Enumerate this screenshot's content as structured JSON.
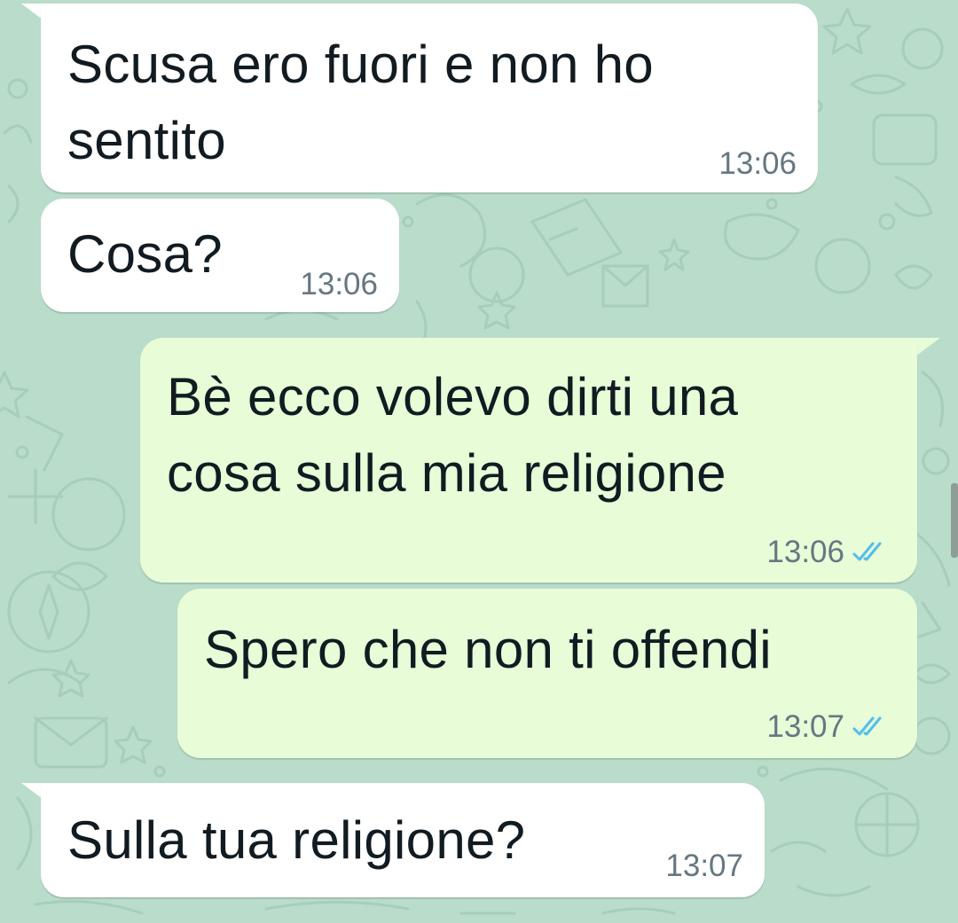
{
  "messages": [
    {
      "direction": "incoming",
      "text_lines": [
        "Scusa ero fuori e non ho",
        "sentito"
      ],
      "time": "13:06"
    },
    {
      "direction": "incoming",
      "text_lines": [
        "Cosa?"
      ],
      "time": "13:06"
    },
    {
      "direction": "outgoing",
      "text_lines": [
        "Bè ecco volevo dirti una",
        "cosa sulla mia religione"
      ],
      "time": "13:06",
      "status": "read",
      "status_icon": "double-check-icon"
    },
    {
      "direction": "outgoing",
      "text_lines": [
        "Spero che non ti offendi"
      ],
      "time": "13:07",
      "status": "read",
      "status_icon": "double-check-icon"
    },
    {
      "direction": "incoming",
      "text_lines": [
        "Sulla tua religione?"
      ],
      "time": "13:07"
    }
  ],
  "colors": {
    "wallpaper": "#b9dccb",
    "incoming_bubble": "#ffffff",
    "outgoing_bubble": "#e7fcd7",
    "text": "#111b21",
    "timestamp": "#667781",
    "read_ticks": "#53bdeb"
  }
}
